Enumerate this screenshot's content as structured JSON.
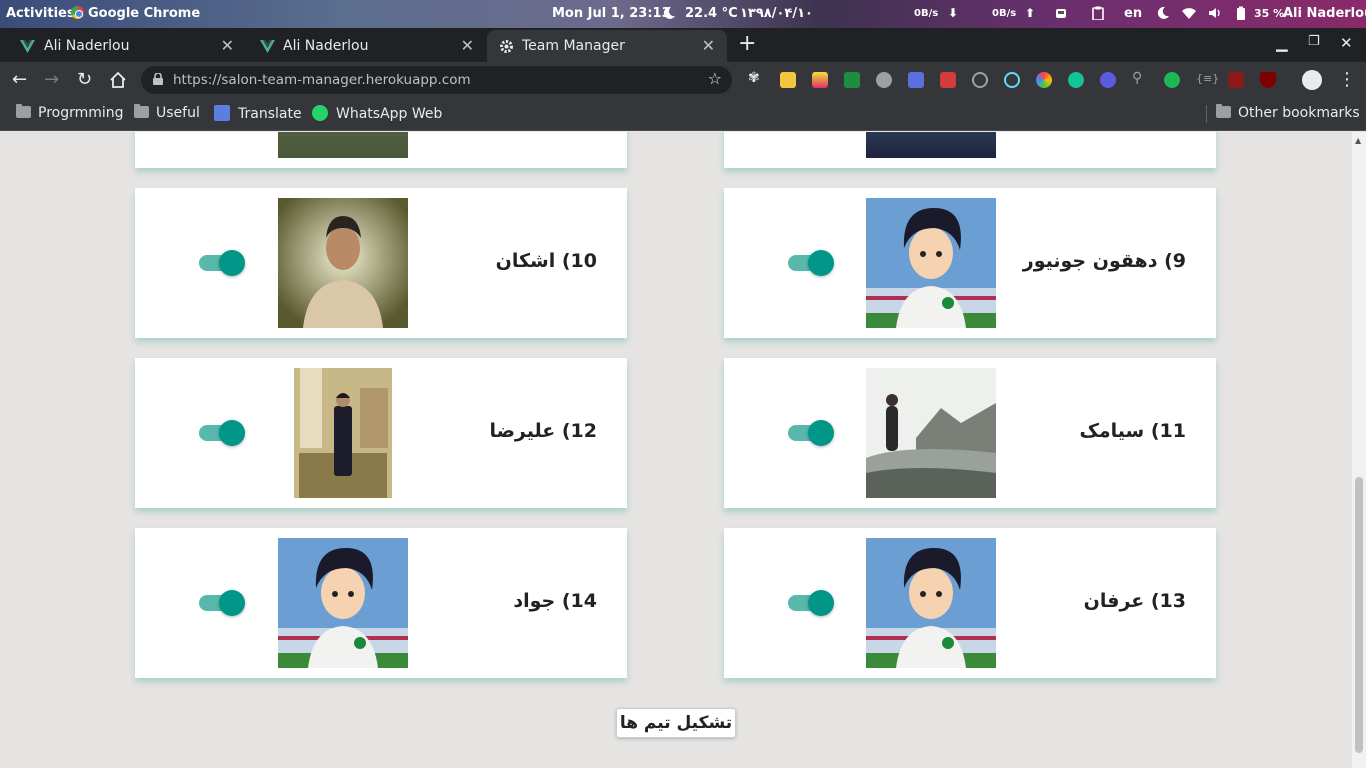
{
  "system_bar": {
    "activities": "Activities",
    "app_name": "Google Chrome",
    "datetime": "Mon Jul  1, 23:13",
    "temperature": "22.4 °C",
    "persian_date": "۱۳۹۸/۰۴/۱۰",
    "net_down": "0B/s",
    "net_up": "0B/s",
    "language": "en",
    "battery": "35 %",
    "user": "Ali Naderlou"
  },
  "tabs": [
    {
      "label": "Ali Naderlou",
      "icon": "vue-icon"
    },
    {
      "label": "Ali Naderlou",
      "icon": "vue-icon"
    },
    {
      "label": "Team Manager",
      "icon": "gear-icon",
      "active": true
    }
  ],
  "omnibox": {
    "url": "https://salon-team-manager.herokuapp.com"
  },
  "bookmarks": [
    {
      "label": "Progrmming",
      "icon": "folder-icon"
    },
    {
      "label": "Useful",
      "icon": "folder-icon"
    },
    {
      "label": "Translate",
      "icon": "google-translate-icon"
    },
    {
      "label": "WhatsApp Web",
      "icon": "whatsapp-icon"
    }
  ],
  "other_bookmarks": "Other bookmarks",
  "players": [
    {
      "name": "9) دهقون جونیور",
      "photo": "anime-avatar",
      "active": true
    },
    {
      "name": "10) اشکان",
      "photo": "person-photo",
      "active": true
    },
    {
      "name": "11) سیامک",
      "photo": "snow-photo",
      "active": true
    },
    {
      "name": "12) علیرضا",
      "photo": "suit-photo",
      "active": true
    },
    {
      "name": "13) عرفان",
      "photo": "anime-avatar",
      "active": true
    },
    {
      "name": "14) جواد",
      "photo": "anime-avatar",
      "active": true
    }
  ],
  "submit_label": "تشکیل تیم ها",
  "colors": {
    "accent": "#009688",
    "accent_track": "#58b8ac"
  }
}
